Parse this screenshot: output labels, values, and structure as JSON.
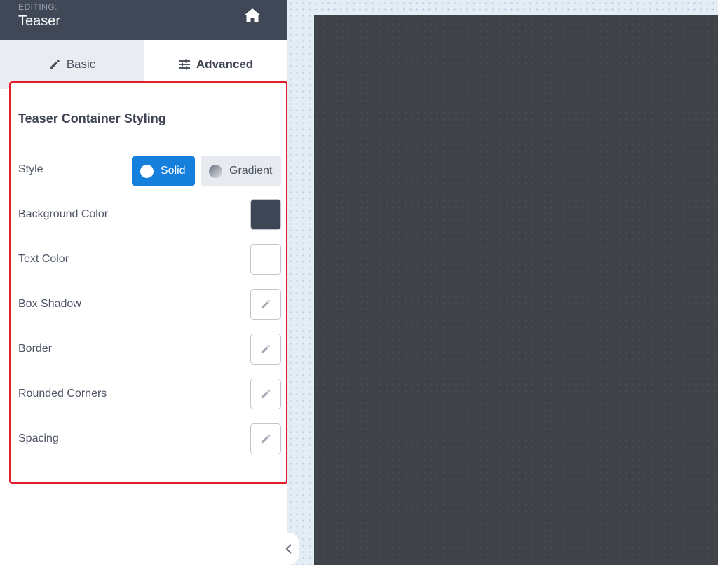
{
  "header": {
    "eyebrow": "EDITING:",
    "title": "Teaser",
    "home_icon": "home-icon"
  },
  "tabs": [
    {
      "label": "Basic",
      "icon": "pencil-icon",
      "active": false
    },
    {
      "label": "Advanced",
      "icon": "sliders-icon",
      "active": true
    }
  ],
  "section": {
    "title": "Teaser Container Styling"
  },
  "style_row": {
    "label": "Style",
    "options": [
      {
        "label": "Solid",
        "selected": true
      },
      {
        "label": "Gradient",
        "selected": false
      }
    ]
  },
  "rows": {
    "background_color": {
      "label": "Background Color",
      "value": "#3e4555"
    },
    "text_color": {
      "label": "Text Color",
      "value": "#ffffff"
    },
    "box_shadow": {
      "label": "Box Shadow"
    },
    "border": {
      "label": "Border"
    },
    "rounded_corners": {
      "label": "Rounded Corners"
    },
    "spacing": {
      "label": "Spacing"
    }
  },
  "colors": {
    "header_bg": "#404756",
    "accent": "#1580db",
    "highlight": "#e41e26",
    "canvas_preview": "#3f4246"
  }
}
